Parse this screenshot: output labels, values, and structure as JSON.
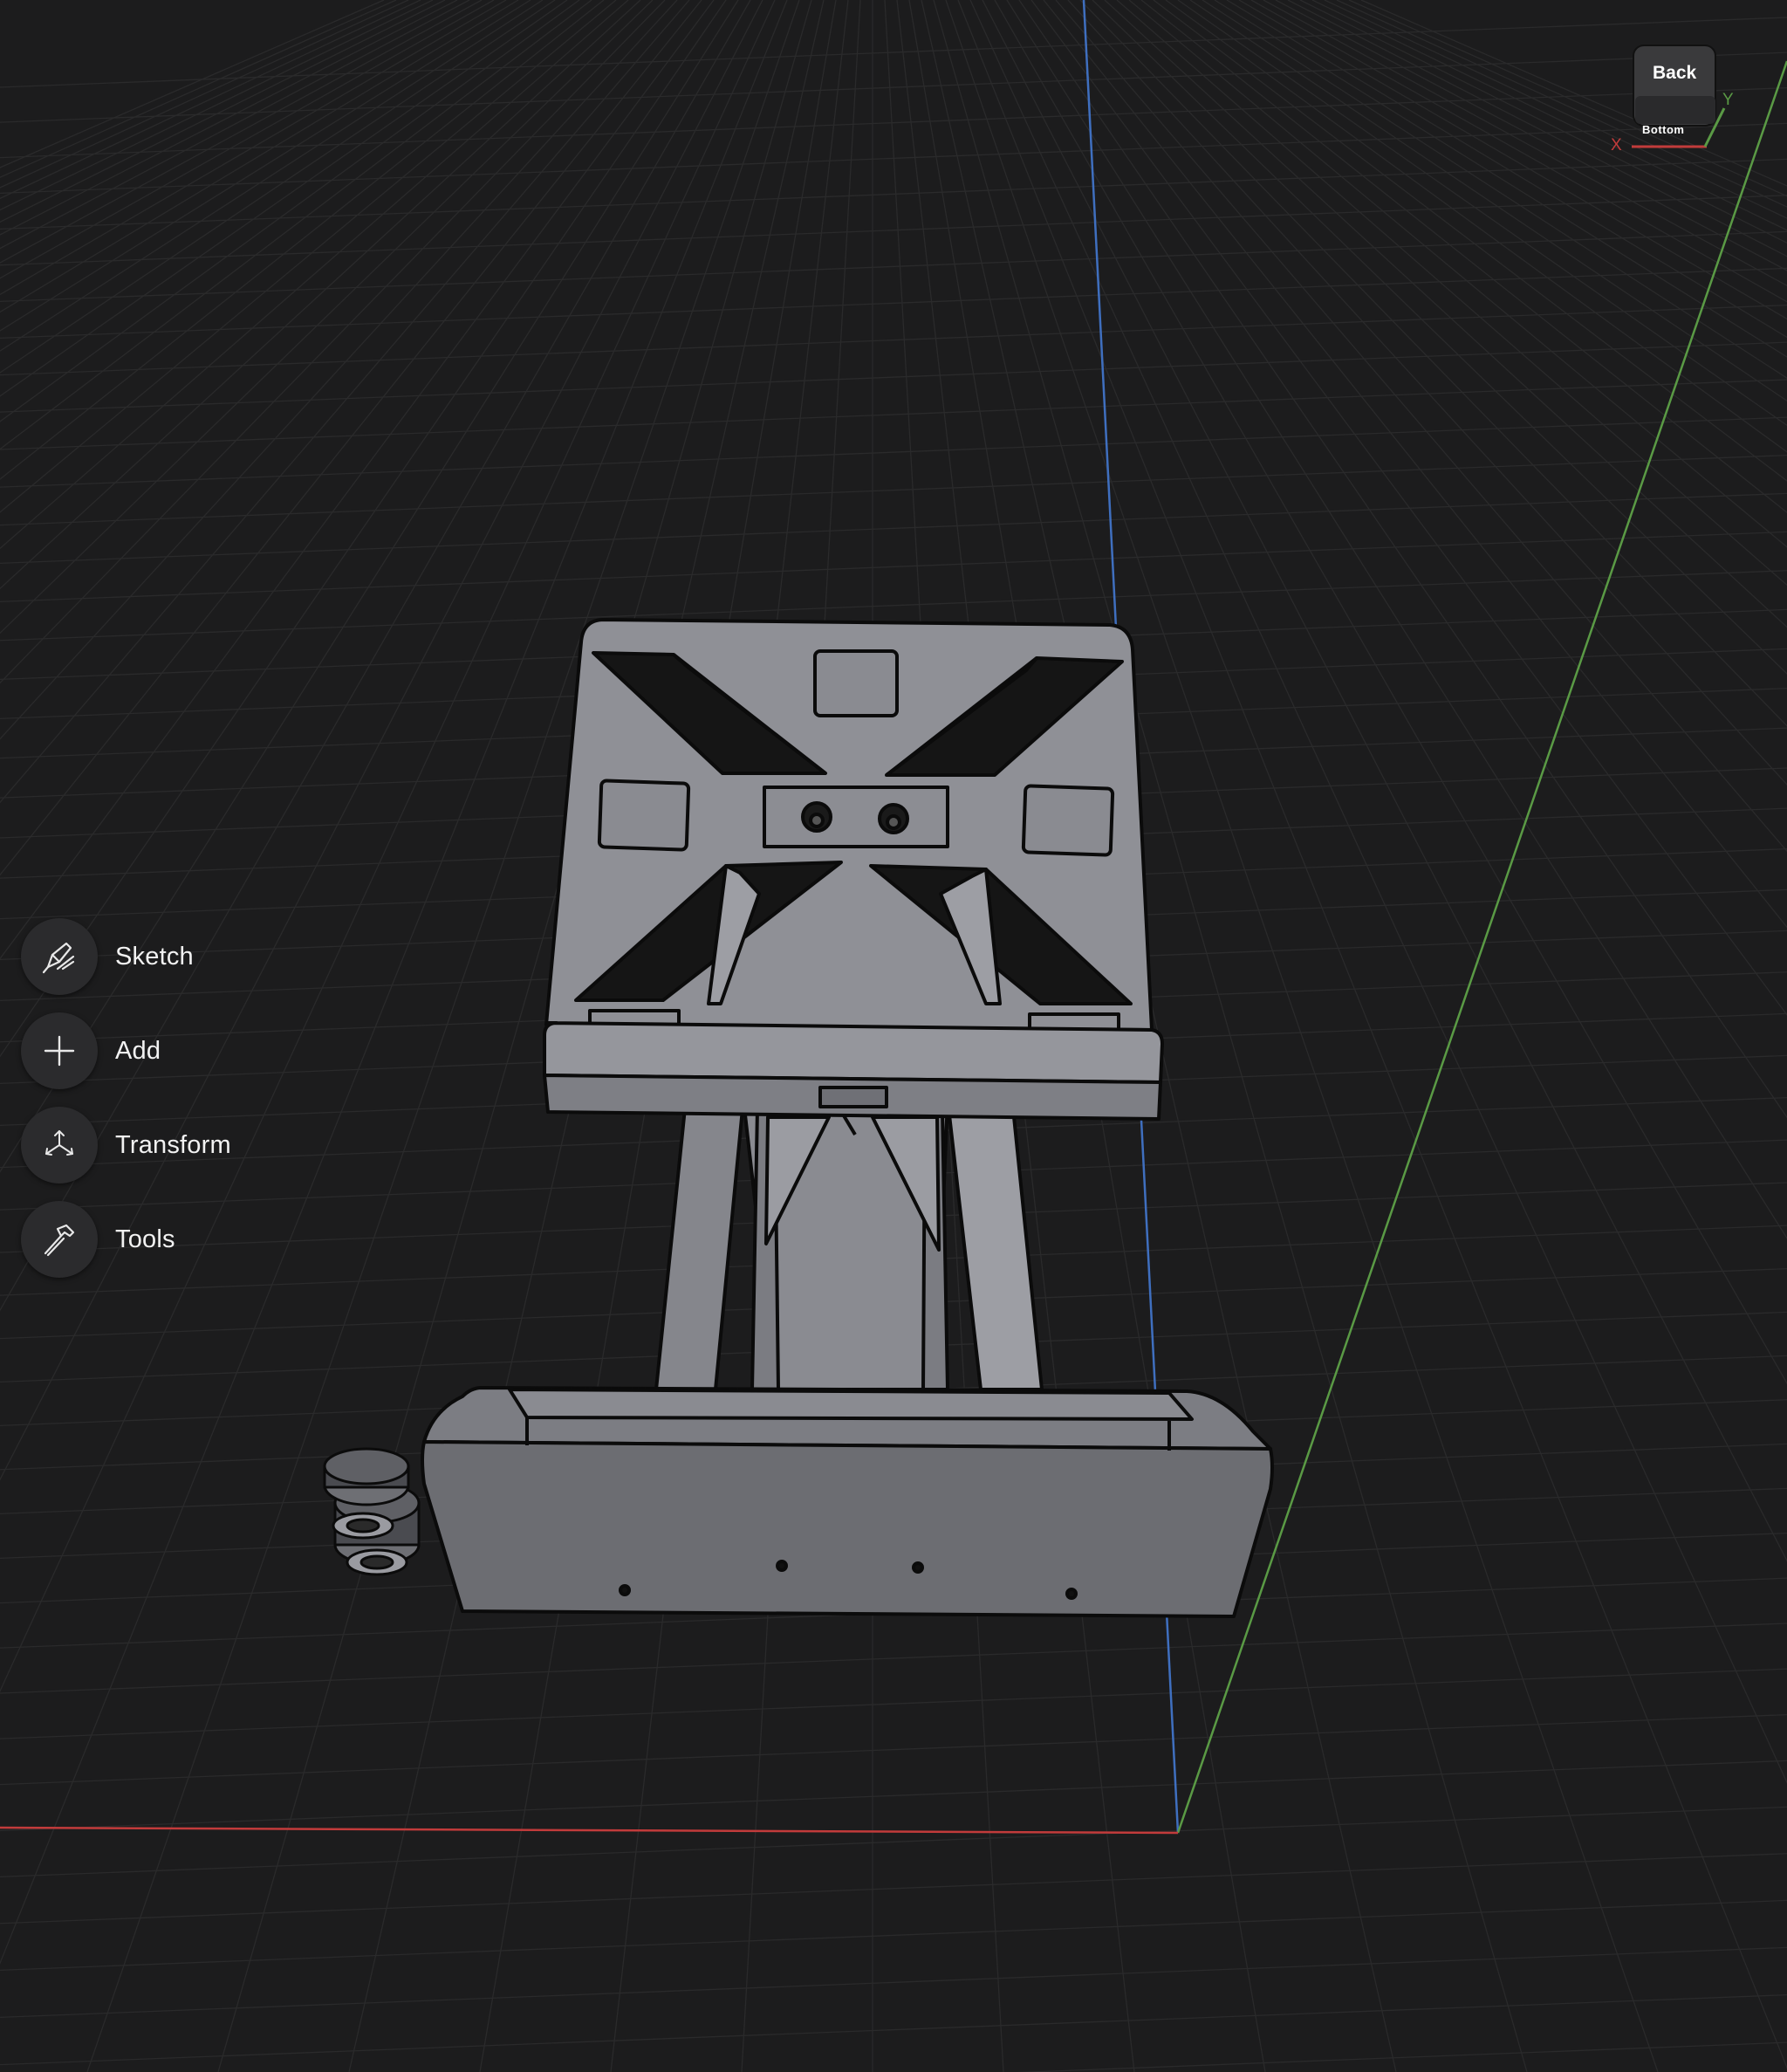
{
  "toolbar": {
    "items": [
      {
        "label": "Sketch",
        "icon": "sketch-pen-icon"
      },
      {
        "label": "Add",
        "icon": "plus-icon"
      },
      {
        "label": "Transform",
        "icon": "transform-arrows-icon"
      },
      {
        "label": "Tools",
        "icon": "hammer-icon"
      }
    ]
  },
  "viewcube": {
    "top_face": "Back",
    "bottom_face": "Bottom",
    "axis_x": "X",
    "axis_y": "Y"
  },
  "colors": {
    "background": "#1c1c1d",
    "grid": "#2a2a2b",
    "axis_x": "#c23b3b",
    "axis_y": "#5a9a45",
    "axis_z": "#3f6fbf",
    "model_face": "#8f9096",
    "model_edge": "#0b0b0b"
  }
}
